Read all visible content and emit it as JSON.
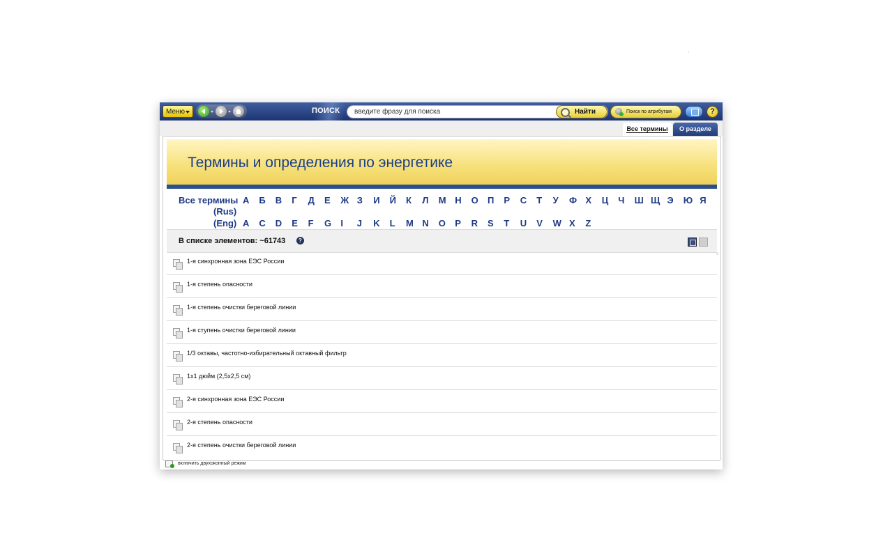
{
  "toolbar": {
    "menu_label": "Меню",
    "search_label": "ПОИСК",
    "search_value": "введите фразу для поиска",
    "find_label": "Найти",
    "attr_search_label": "Поиск по атрибутам",
    "help_label": "?"
  },
  "tabs": [
    {
      "label": "Все термины",
      "active": true
    },
    {
      "label": "О разделе",
      "active": false
    }
  ],
  "header": {
    "title": "Термины и определения по энергетике"
  },
  "alphabet": {
    "all_label": "Все термины",
    "rus_label": "(Rus)",
    "eng_label": "(Eng)",
    "rus": [
      "А",
      "Б",
      "В",
      "Г",
      "Д",
      "Е",
      "Ж",
      "З",
      "И",
      "Й",
      "К",
      "Л",
      "М",
      "Н",
      "О",
      "П",
      "Р",
      "С",
      "Т",
      "У",
      "Ф",
      "Х",
      "Ц",
      "Ч",
      "Ш",
      "Щ",
      "Э",
      "Ю",
      "Я"
    ],
    "eng": [
      "A",
      "C",
      "D",
      "E",
      "F",
      "G",
      "I",
      "J",
      "K",
      "L",
      "M",
      "N",
      "O",
      "P",
      "R",
      "S",
      "T",
      "U",
      "V",
      "W",
      "X",
      "Z"
    ]
  },
  "list": {
    "count_label": "В списке элементов: ~61743",
    "info_icon_label": "?",
    "items": [
      "1-я синхронная зона ЕЭС России",
      "1-я степень опасности",
      "1-я степень очистки береговой линии",
      "1-я ступень очистки береговой линии",
      "1/3 октавы, частотно-избирательный октавный фильтр",
      "1x1 дюйм (2,5x2,5 см)",
      "2-я синхронная зона ЕЭС России",
      "2-я степень опасности",
      "2-я степень очистки береговой линии"
    ]
  },
  "footer": {
    "dual_window_label": "включить двухоконный режим"
  },
  "colors": {
    "toolbar": "#1d3474",
    "accent_blue": "#1e3a86",
    "header_yellow": "#f7e07a",
    "button_yellow": "#e7cf36"
  }
}
